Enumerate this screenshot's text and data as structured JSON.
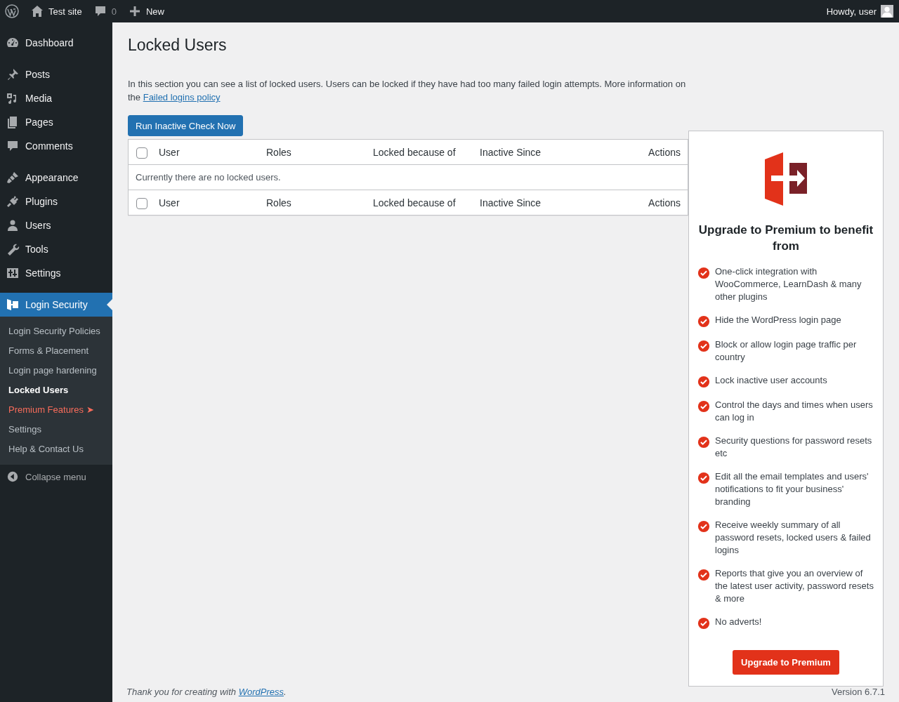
{
  "admin_bar": {
    "site": "Test site",
    "comments": "0",
    "new": "New",
    "howdy": "Howdy, user"
  },
  "sidebar": {
    "groups": [
      [
        {
          "label": "Dashboard",
          "selected": false
        }
      ],
      [
        {
          "label": "Posts",
          "selected": false
        },
        {
          "label": "Media",
          "selected": false
        },
        {
          "label": "Pages",
          "selected": false
        },
        {
          "label": "Comments",
          "selected": false
        }
      ],
      [
        {
          "label": "Appearance",
          "selected": false
        },
        {
          "label": "Plugins",
          "selected": false
        },
        {
          "label": "Users",
          "selected": false
        },
        {
          "label": "Tools",
          "selected": false
        },
        {
          "label": "Settings",
          "selected": false
        }
      ],
      [
        {
          "label": "Login Security",
          "selected": true
        }
      ]
    ],
    "submenu": [
      {
        "label": "Login Security Policies",
        "selected": false,
        "kind": "plain"
      },
      {
        "label": "Forms & Placement",
        "selected": false,
        "kind": "plain"
      },
      {
        "label": "Login page hardening",
        "selected": false,
        "kind": "plain"
      },
      {
        "label": "Locked Users",
        "selected": true,
        "kind": "plain"
      },
      {
        "label": "Premium Features ➤",
        "selected": false,
        "kind": "premium"
      },
      {
        "label": "Settings",
        "selected": false,
        "kind": "plain"
      },
      {
        "label": "Help & Contact Us",
        "selected": false,
        "kind": "plain"
      }
    ],
    "collapse": "Collapse menu"
  },
  "page": {
    "title": "Locked Users",
    "description": "In this section you can see a list of locked users. Users can be locked if they have had too many failed login attempts. More information on the ",
    "link": "Failed logins policy",
    "button": "Run Inactive Check Now"
  },
  "table": {
    "header_columns": [
      "User",
      "Roles",
      "Locked because of",
      "Inactive Since",
      "Actions"
    ],
    "footer_columns": [
      "User",
      "Roles",
      "Locked because of",
      "Inactive Since",
      "Actions"
    ],
    "header_checked": false,
    "footer_checked": false,
    "empty": "Currently there are no locked users."
  },
  "premium": {
    "title": "Upgrade to Premium to benefit from",
    "features": [
      "One-click integration with WooCommerce, LearnDash & many other plugins",
      "Hide the WordPress login page",
      "Block or allow login page traffic per country",
      "Lock inactive user accounts",
      "Control the days and times when users can log in",
      "Security questions for password resets etc",
      "Edit all the email templates and users' notifications to fit your business' branding",
      "Receive weekly summary of all password resets, locked users & failed logins",
      "Reports that give you an overview of the latest user activity, password resets & more",
      "No adverts!"
    ],
    "button": "Upgrade to Premium"
  },
  "footer": {
    "thanks": "Thank you for creating with ",
    "link": "WordPress",
    "after": ".",
    "version": "Version 6.7.1"
  }
}
